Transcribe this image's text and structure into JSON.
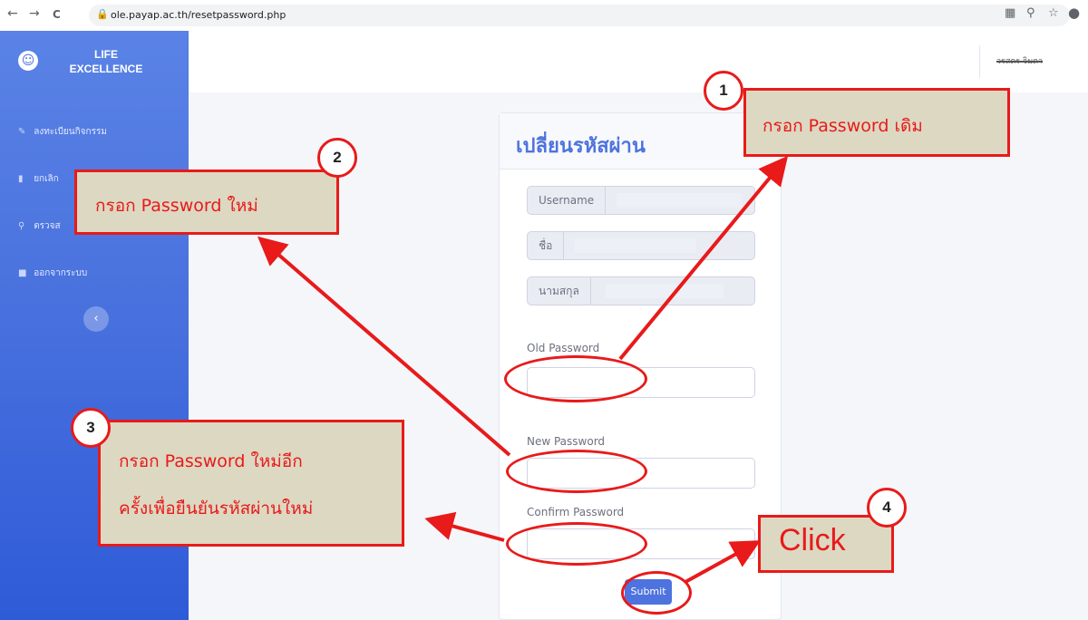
{
  "browser": {
    "url": "ole.payap.ac.th/resetpassword.php",
    "nav_back": "←",
    "nav_forward": "→",
    "nav_reload": "C"
  },
  "sidebar": {
    "brand_line1": "LIFE",
    "brand_line2": "EXCELLENCE",
    "items": [
      {
        "icon": "pencil-icon",
        "label": "ลงทะเบียนกิจกรรม"
      },
      {
        "icon": "trash-icon",
        "label": "ยกเลิก"
      },
      {
        "icon": "search-icon",
        "label": "ตรวจส"
      },
      {
        "icon": "lock-icon",
        "label": "ออกจากระบบ"
      }
    ],
    "collapse_glyph": "‹"
  },
  "topbar": {
    "user_name": "วรสตร จิมตา"
  },
  "form": {
    "title": "เปลี่ยนรหัสผ่าน",
    "username_label": "Username",
    "firstname_label": "ชื่อ",
    "lastname_label": "นามสกุล",
    "old_password_label": "Old Password",
    "new_password_label": "New Password",
    "confirm_password_label": "Confirm Password",
    "submit_label": "Submit"
  },
  "annotations": {
    "accent_color": "#e81a1a",
    "callout_bg": "#ddd8c2",
    "steps": [
      {
        "number": "1",
        "text": "กรอก Password เดิม"
      },
      {
        "number": "2",
        "text": "กรอก Password ใหม่"
      },
      {
        "number": "3",
        "line1": "กรอก Password ใหม่อีก",
        "line2": "ครั้งเพื่อยืนยันรหัสผ่านใหม่"
      },
      {
        "number": "4",
        "text": "Click"
      }
    ]
  }
}
